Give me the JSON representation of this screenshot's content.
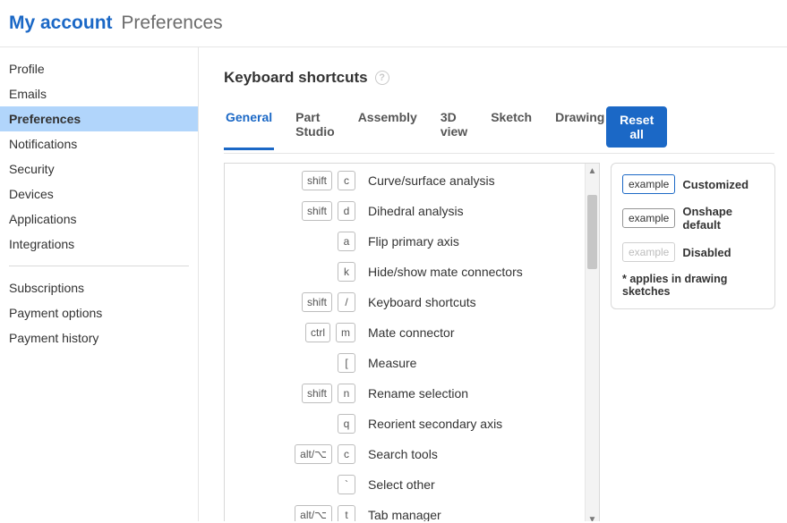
{
  "header": {
    "title": "My account",
    "subtitle": "Preferences"
  },
  "sidebar": {
    "groups": [
      {
        "items": [
          {
            "id": "profile",
            "label": "Profile"
          },
          {
            "id": "emails",
            "label": "Emails"
          },
          {
            "id": "preferences",
            "label": "Preferences",
            "active": true
          },
          {
            "id": "notifications",
            "label": "Notifications"
          },
          {
            "id": "security",
            "label": "Security"
          },
          {
            "id": "devices",
            "label": "Devices"
          },
          {
            "id": "applications",
            "label": "Applications"
          },
          {
            "id": "integrations",
            "label": "Integrations"
          }
        ]
      },
      {
        "items": [
          {
            "id": "subscriptions",
            "label": "Subscriptions"
          },
          {
            "id": "payment-options",
            "label": "Payment options"
          },
          {
            "id": "payment-history",
            "label": "Payment history"
          }
        ]
      }
    ]
  },
  "section": {
    "title": "Keyboard shortcuts"
  },
  "tabs": [
    {
      "id": "general",
      "label": "General",
      "active": true
    },
    {
      "id": "partstudio",
      "label": "Part Studio"
    },
    {
      "id": "assembly",
      "label": "Assembly"
    },
    {
      "id": "3dview",
      "label": "3D view"
    },
    {
      "id": "sketch",
      "label": "Sketch"
    },
    {
      "id": "drawing",
      "label": "Drawing"
    }
  ],
  "reset_button": "Reset all",
  "shortcuts": [
    {
      "keys": [
        "shift",
        "c"
      ],
      "desc": "Curve/surface analysis"
    },
    {
      "keys": [
        "shift",
        "d"
      ],
      "desc": "Dihedral analysis"
    },
    {
      "keys": [
        "a"
      ],
      "desc": "Flip primary axis"
    },
    {
      "keys": [
        "k"
      ],
      "desc": "Hide/show mate connectors"
    },
    {
      "keys": [
        "shift",
        "/"
      ],
      "desc": "Keyboard shortcuts"
    },
    {
      "keys": [
        "ctrl",
        "m"
      ],
      "desc": "Mate connector"
    },
    {
      "keys": [
        "["
      ],
      "desc": "Measure"
    },
    {
      "keys": [
        "shift",
        "n"
      ],
      "desc": "Rename selection"
    },
    {
      "keys": [
        "q"
      ],
      "desc": "Reorient secondary axis"
    },
    {
      "keys": [
        "alt/⌥",
        "c"
      ],
      "desc": "Search tools"
    },
    {
      "keys": [
        "`"
      ],
      "desc": "Select other"
    },
    {
      "keys": [
        "alt/⌥",
        "t"
      ],
      "desc": "Tab manager"
    }
  ],
  "scrollbar": {
    "thumb_top_pct": 5,
    "thumb_height_pct": 22
  },
  "legend": {
    "badge_label": "example",
    "items": [
      {
        "style": "customized",
        "label": "Customized"
      },
      {
        "style": "default",
        "label": "Onshape default"
      },
      {
        "style": "disabled",
        "label": "Disabled"
      }
    ],
    "note": "* applies in drawing sketches"
  }
}
